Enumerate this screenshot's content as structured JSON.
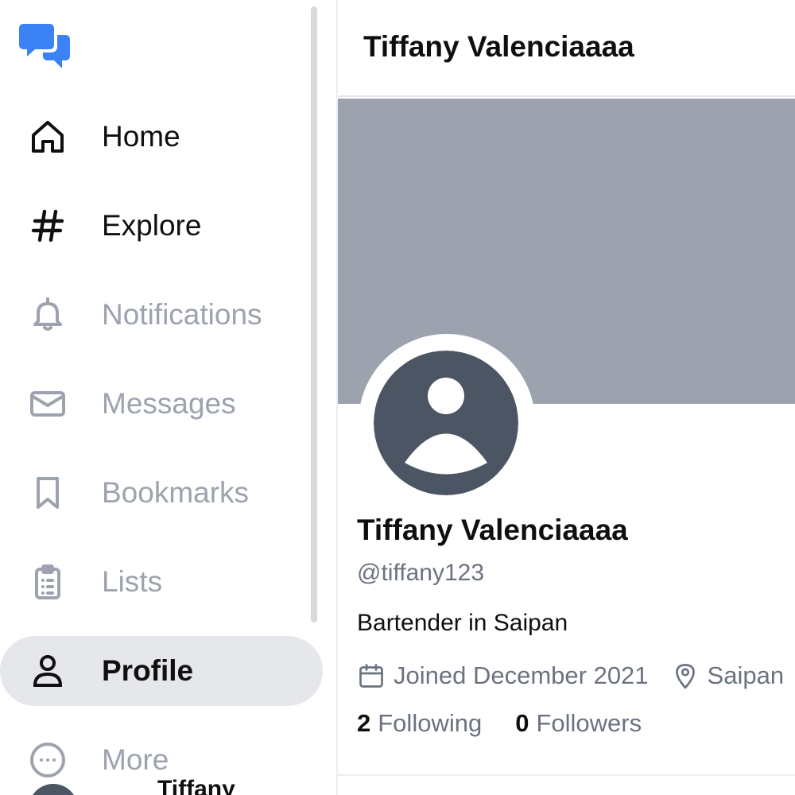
{
  "app": {
    "logo_icon": "chat-bubbles-icon",
    "accent_color": "#3b82f6"
  },
  "sidebar": {
    "items": [
      {
        "label": "Home",
        "icon": "home-icon",
        "state": "enabled"
      },
      {
        "label": "Explore",
        "icon": "hashtag-icon",
        "state": "enabled"
      },
      {
        "label": "Notifications",
        "icon": "bell-icon",
        "state": "disabled"
      },
      {
        "label": "Messages",
        "icon": "envelope-icon",
        "state": "disabled"
      },
      {
        "label": "Bookmarks",
        "icon": "bookmark-icon",
        "state": "disabled"
      },
      {
        "label": "Lists",
        "icon": "clipboard-list-icon",
        "state": "disabled"
      },
      {
        "label": "Profile",
        "icon": "user-icon",
        "state": "active"
      },
      {
        "label": "More",
        "icon": "ellipsis-circle-icon",
        "state": "disabled"
      }
    ],
    "account": {
      "name": "Tiffany"
    }
  },
  "header": {
    "title": "Tiffany Valenciaaaa"
  },
  "profile": {
    "banner_color": "#9ca3af",
    "display_name": "Tiffany Valenciaaaa",
    "handle": "@tiffany123",
    "bio": "Bartender in Saipan",
    "joined": "Joined December 2021",
    "location": "Saipan",
    "following_count": "2",
    "following_label": "Following",
    "followers_count": "0",
    "followers_label": "Followers"
  }
}
